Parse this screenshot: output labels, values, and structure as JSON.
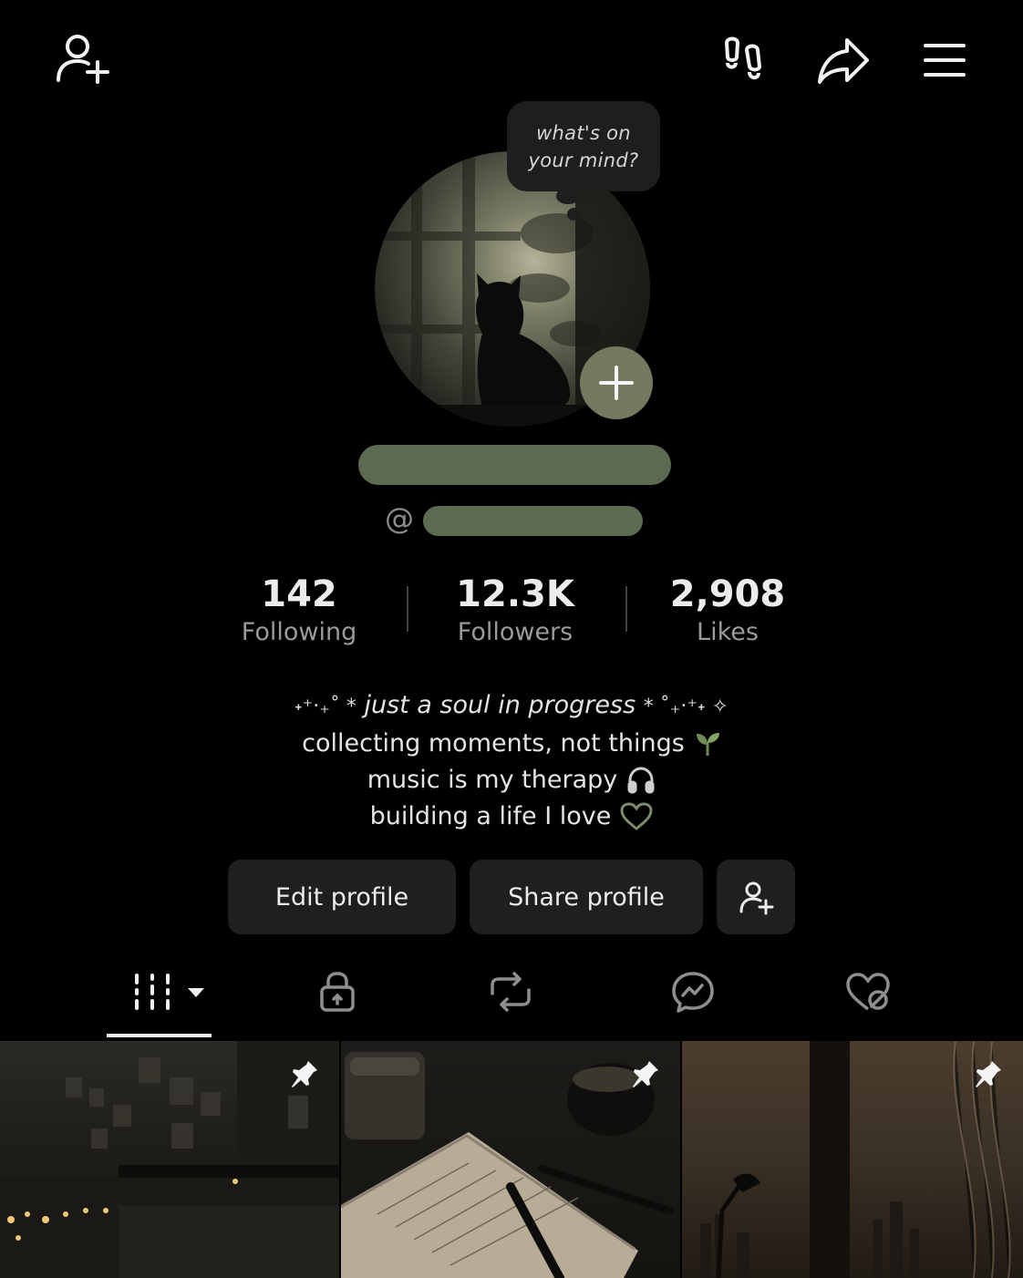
{
  "header": {
    "icons": [
      "add-friend-icon",
      "footprints-icon",
      "share-icon",
      "menu-icon"
    ]
  },
  "avatar": {
    "thought_bubble_lines": [
      "what's on",
      "your mind?"
    ],
    "add_story_icon": "plus-icon"
  },
  "handle_prefix": "@",
  "stats": [
    {
      "value": "142",
      "label": "Following"
    },
    {
      "value": "12.3K",
      "label": "Followers"
    },
    {
      "value": "2,908",
      "label": "Likes"
    }
  ],
  "bio": {
    "line1": {
      "pre": "˖⁺‧₊˚ *",
      "text": "just a soul in progress",
      "post": "* ˚₊‧⁺˖ ✧"
    },
    "line2": "collecting moments, not things",
    "line3": "music is my therapy",
    "line4": "building a life I love"
  },
  "actions": {
    "edit_label": "Edit profile",
    "share_label": "Share profile"
  },
  "tabs": [
    "videos-grid-icon",
    "private-lock-icon",
    "repost-icon",
    "messenger-icon",
    "liked-hidden-icon"
  ],
  "posts": [
    {
      "scene": "bedroom with fairy lights",
      "pinned": true
    },
    {
      "scene": "journal with candle and coffee",
      "pinned": true
    },
    {
      "scene": "window lamp city view",
      "pinned": true
    }
  ],
  "colors": {
    "background": "#000000",
    "accent_green": "#5c6a52",
    "button_bg": "#1f1f1f",
    "stat_label": "#9a9a9a"
  }
}
